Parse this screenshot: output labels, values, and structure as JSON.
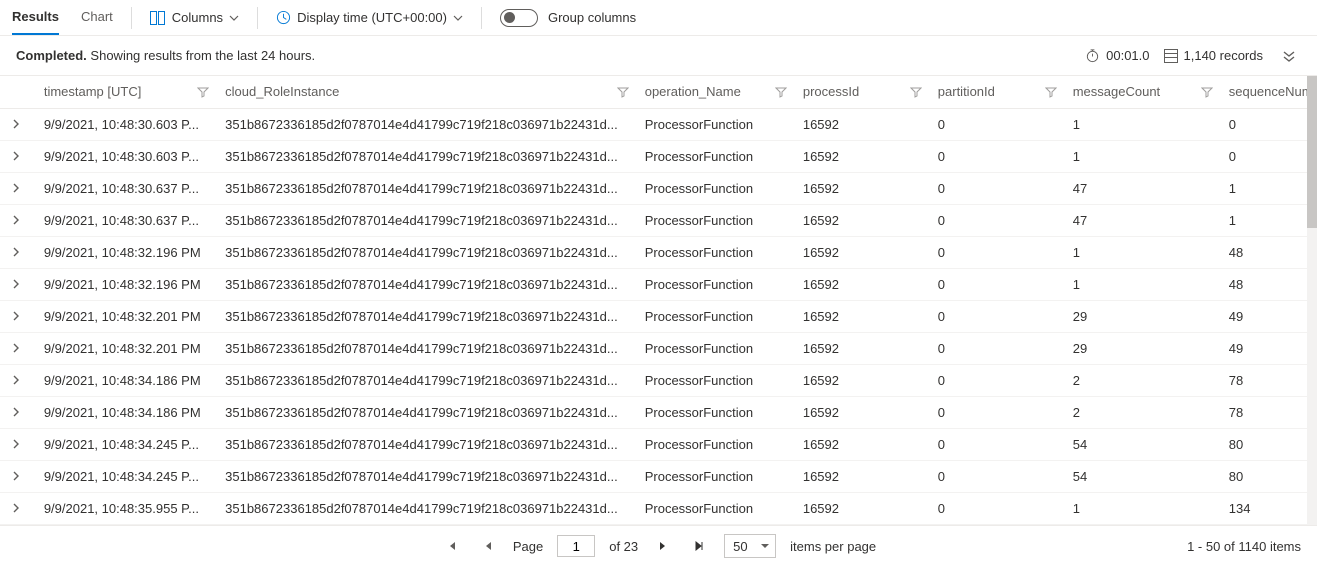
{
  "tabs": {
    "results": "Results",
    "chart": "Chart"
  },
  "toolbar": {
    "columns": "Columns",
    "display_time": "Display time (UTC+00:00)",
    "group_columns": "Group columns"
  },
  "status": {
    "completed": "Completed.",
    "summary": "Showing results from the last 24 hours.",
    "duration": "00:01.0",
    "records": "1,140 records"
  },
  "columns": {
    "timestamp": "timestamp [UTC]",
    "role": "cloud_RoleInstance",
    "op": "operation_Name",
    "pid": "processId",
    "part": "partitionId",
    "mc": "messageCount",
    "seq": "sequenceNumberStart"
  },
  "rows": [
    {
      "ts": "9/9/2021, 10:48:30.603 P...",
      "ri": "351b8672336185d2f0787014e4d41799c719f218c036971b22431d...",
      "op": "ProcessorFunction",
      "pid": "16592",
      "part": "0",
      "mc": "1",
      "seq": "0"
    },
    {
      "ts": "9/9/2021, 10:48:30.603 P...",
      "ri": "351b8672336185d2f0787014e4d41799c719f218c036971b22431d...",
      "op": "ProcessorFunction",
      "pid": "16592",
      "part": "0",
      "mc": "1",
      "seq": "0"
    },
    {
      "ts": "9/9/2021, 10:48:30.637 P...",
      "ri": "351b8672336185d2f0787014e4d41799c719f218c036971b22431d...",
      "op": "ProcessorFunction",
      "pid": "16592",
      "part": "0",
      "mc": "47",
      "seq": "1"
    },
    {
      "ts": "9/9/2021, 10:48:30.637 P...",
      "ri": "351b8672336185d2f0787014e4d41799c719f218c036971b22431d...",
      "op": "ProcessorFunction",
      "pid": "16592",
      "part": "0",
      "mc": "47",
      "seq": "1"
    },
    {
      "ts": "9/9/2021, 10:48:32.196 PM",
      "ri": "351b8672336185d2f0787014e4d41799c719f218c036971b22431d...",
      "op": "ProcessorFunction",
      "pid": "16592",
      "part": "0",
      "mc": "1",
      "seq": "48"
    },
    {
      "ts": "9/9/2021, 10:48:32.196 PM",
      "ri": "351b8672336185d2f0787014e4d41799c719f218c036971b22431d...",
      "op": "ProcessorFunction",
      "pid": "16592",
      "part": "0",
      "mc": "1",
      "seq": "48"
    },
    {
      "ts": "9/9/2021, 10:48:32.201 PM",
      "ri": "351b8672336185d2f0787014e4d41799c719f218c036971b22431d...",
      "op": "ProcessorFunction",
      "pid": "16592",
      "part": "0",
      "mc": "29",
      "seq": "49"
    },
    {
      "ts": "9/9/2021, 10:48:32.201 PM",
      "ri": "351b8672336185d2f0787014e4d41799c719f218c036971b22431d...",
      "op": "ProcessorFunction",
      "pid": "16592",
      "part": "0",
      "mc": "29",
      "seq": "49"
    },
    {
      "ts": "9/9/2021, 10:48:34.186 PM",
      "ri": "351b8672336185d2f0787014e4d41799c719f218c036971b22431d...",
      "op": "ProcessorFunction",
      "pid": "16592",
      "part": "0",
      "mc": "2",
      "seq": "78"
    },
    {
      "ts": "9/9/2021, 10:48:34.186 PM",
      "ri": "351b8672336185d2f0787014e4d41799c719f218c036971b22431d...",
      "op": "ProcessorFunction",
      "pid": "16592",
      "part": "0",
      "mc": "2",
      "seq": "78"
    },
    {
      "ts": "9/9/2021, 10:48:34.245 P...",
      "ri": "351b8672336185d2f0787014e4d41799c719f218c036971b22431d...",
      "op": "ProcessorFunction",
      "pid": "16592",
      "part": "0",
      "mc": "54",
      "seq": "80"
    },
    {
      "ts": "9/9/2021, 10:48:34.245 P...",
      "ri": "351b8672336185d2f0787014e4d41799c719f218c036971b22431d...",
      "op": "ProcessorFunction",
      "pid": "16592",
      "part": "0",
      "mc": "54",
      "seq": "80"
    },
    {
      "ts": "9/9/2021, 10:48:35.955 P...",
      "ri": "351b8672336185d2f0787014e4d41799c719f218c036971b22431d...",
      "op": "ProcessorFunction",
      "pid": "16592",
      "part": "0",
      "mc": "1",
      "seq": "134"
    }
  ],
  "pager": {
    "page_label": "Page",
    "page": "1",
    "of": "of 23",
    "size": "50",
    "per_page": "items per page",
    "range": "1 - 50 of 1140 items"
  }
}
